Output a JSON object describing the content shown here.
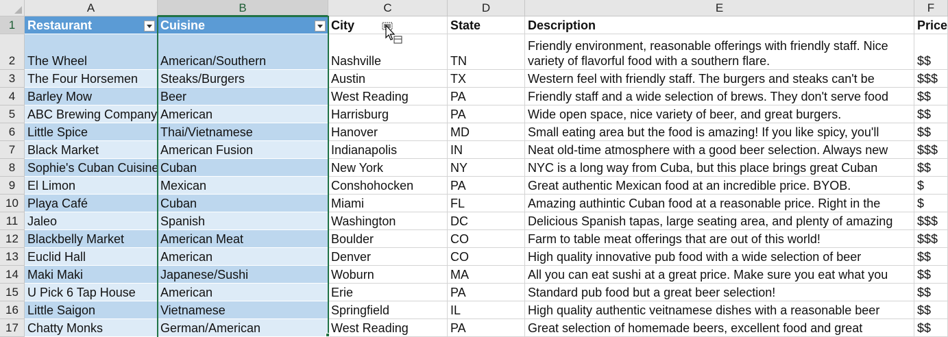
{
  "sheet": {
    "columns": [
      {
        "id": "A",
        "label": "A"
      },
      {
        "id": "B",
        "label": "B"
      },
      {
        "id": "C",
        "label": "C"
      },
      {
        "id": "D",
        "label": "D"
      },
      {
        "id": "E",
        "label": "E"
      },
      {
        "id": "F",
        "label": "F"
      }
    ],
    "selected_column": "B",
    "header_row": {
      "row_number": "1",
      "cells": [
        "Restaurant",
        "Cuisine",
        "City",
        "State",
        "Description",
        "Price"
      ]
    },
    "rows": [
      {
        "row_number": "2",
        "cells": [
          "The Wheel",
          "American/Southern",
          "Nashville",
          "TN",
          "Friendly environment, reasonable offerings with friendly staff. Nice variety of flavorful food with a southern flare.",
          "$$"
        ]
      },
      {
        "row_number": "3",
        "cells": [
          "The Four Horsemen",
          "Steaks/Burgers",
          "Austin",
          "TX",
          "Western feel with friendly staff. The burgers and steaks can't be",
          "$$$"
        ]
      },
      {
        "row_number": "4",
        "cells": [
          "Barley Mow",
          "Beer",
          "West Reading",
          "PA",
          "Friendly staff and a wide selection of brews. They don't serve food",
          "$$"
        ]
      },
      {
        "row_number": "5",
        "cells": [
          "ABC Brewing Company",
          "American",
          "Harrisburg",
          "PA",
          "Wide open space, nice variety of beer, and great burgers.",
          "$$"
        ]
      },
      {
        "row_number": "6",
        "cells": [
          "Little Spice",
          "Thai/Vietnamese",
          "Hanover",
          "MD",
          "Small eating area but the food is amazing! If you like spicy, you'll",
          "$$"
        ]
      },
      {
        "row_number": "7",
        "cells": [
          "Black Market",
          "American Fusion",
          "Indianapolis",
          "IN",
          "Neat old-time atmosphere with a good beer selection. Always new",
          "$$$"
        ]
      },
      {
        "row_number": "8",
        "cells": [
          "Sophie's Cuban Cuisine",
          "Cuban",
          "New York",
          "NY",
          "NYC is a long way from Cuba, but this place brings great Cuban",
          "$$"
        ]
      },
      {
        "row_number": "9",
        "cells": [
          "El Limon",
          "Mexican",
          "Conshohocken",
          "PA",
          "Great authentic Mexican food at an incredible price. BYOB.",
          "$"
        ]
      },
      {
        "row_number": "10",
        "cells": [
          "Playa Café",
          "Cuban",
          "Miami",
          "FL",
          "Amazing authintic Cuban food at a reasonable price. Right in the",
          "$"
        ]
      },
      {
        "row_number": "11",
        "cells": [
          "Jaleo",
          "Spanish",
          "Washington",
          "DC",
          "Delicious Spanish tapas, large seating area, and plenty of amazing",
          "$$$"
        ]
      },
      {
        "row_number": "12",
        "cells": [
          "Blackbelly Market",
          "American Meat",
          "Boulder",
          "CO",
          "Farm to table meat offerings that are out of this world!",
          "$$$"
        ]
      },
      {
        "row_number": "13",
        "cells": [
          "Euclid Hall",
          "American",
          "Denver",
          "CO",
          "High quality innovative pub food with a wide selection of beer",
          "$$"
        ]
      },
      {
        "row_number": "14",
        "cells": [
          "Maki Maki",
          "Japanese/Sushi",
          "Woburn",
          "MA",
          "All you can eat sushi at a great price. Make sure you eat what you",
          "$$"
        ]
      },
      {
        "row_number": "15",
        "cells": [
          "U Pick 6 Tap House",
          "American",
          "Erie",
          "PA",
          "Standard pub food but a great beer selection!",
          "$$"
        ]
      },
      {
        "row_number": "16",
        "cells": [
          "Little Saigon",
          "Vietnamese",
          "Springfield",
          "IL",
          "High quality authentic veitnamese dishes with a reasonable beer",
          "$$"
        ]
      },
      {
        "row_number": "17",
        "cells": [
          "Chatty Monks",
          "German/American",
          "West Reading",
          "PA",
          "Great selection of homemade beers, excellent food and great",
          "$$"
        ]
      }
    ]
  },
  "icons": {
    "filter": "filter-dropdown-icon",
    "cursor": "move-column-cursor-icon",
    "select_all": "select-all-icon"
  },
  "colors": {
    "table_header": "#5b9bd5",
    "band_dark": "#bdd7ee",
    "band_light": "#ddebf7",
    "selection": "#217346"
  }
}
